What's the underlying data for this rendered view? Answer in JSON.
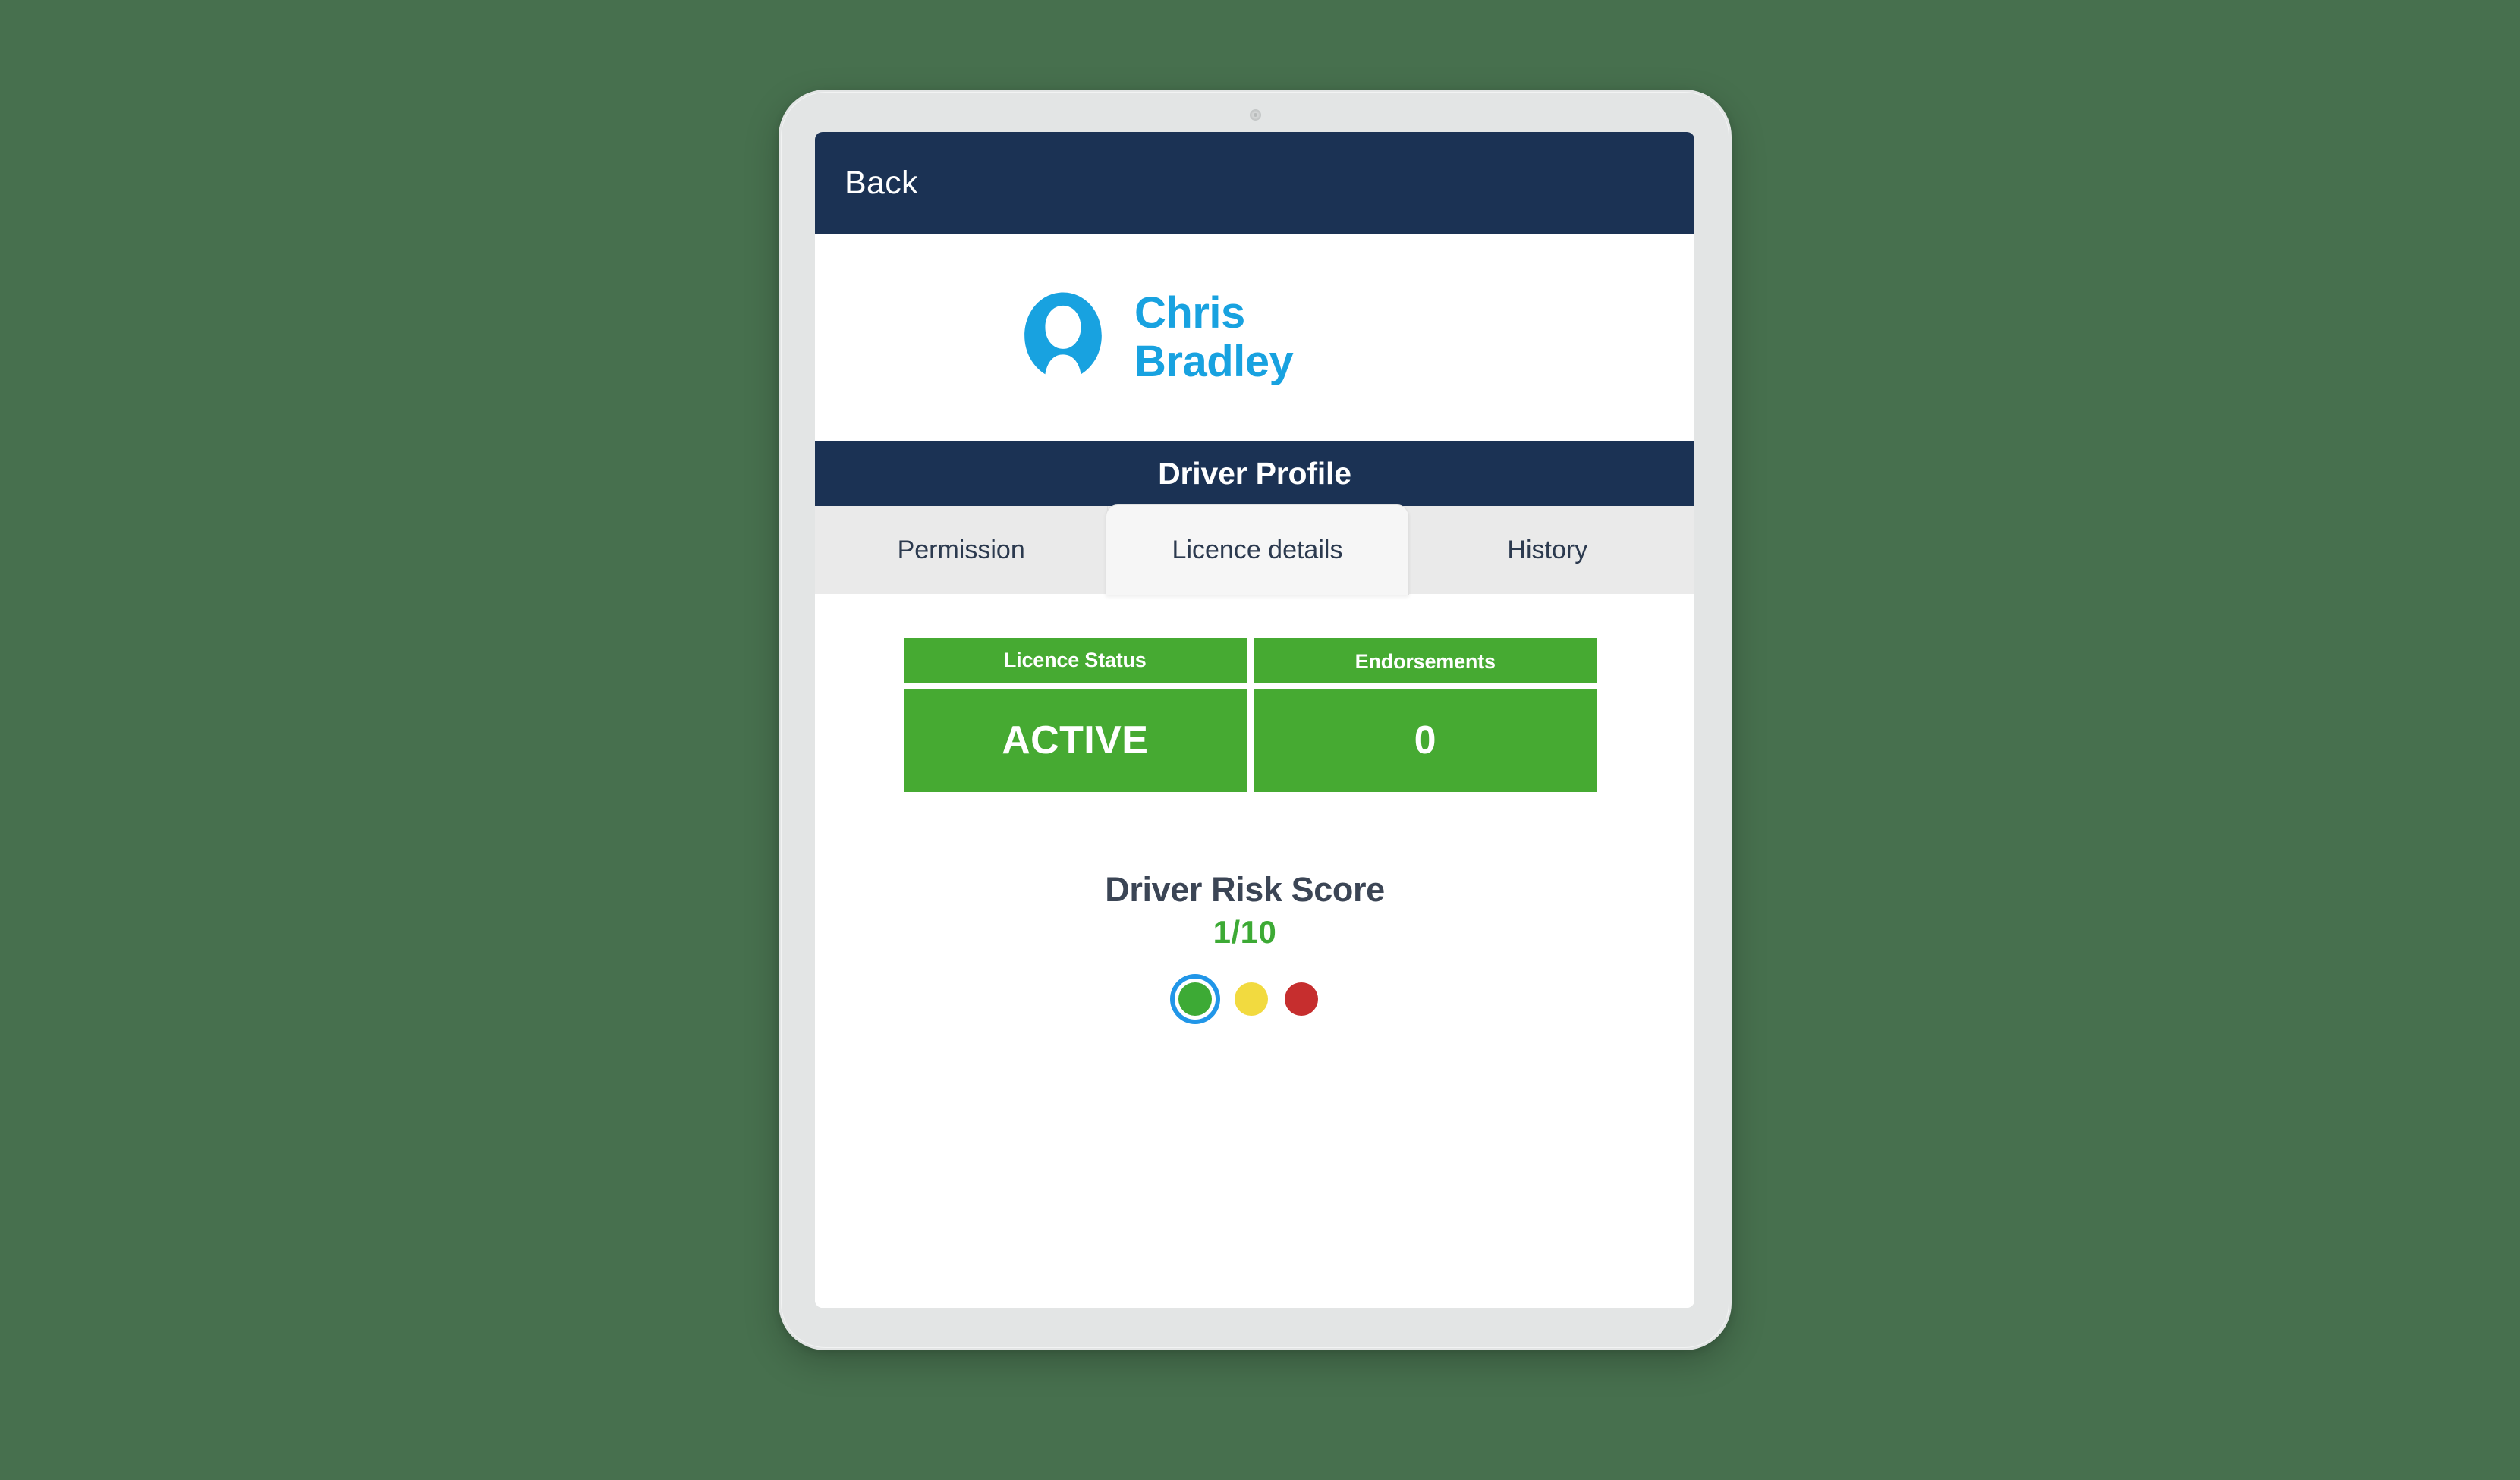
{
  "device": {
    "type": "tablet",
    "camera_icon": "front-camera-icon"
  },
  "topbar": {
    "back_label": "Back"
  },
  "driver": {
    "name_line1": "Chris",
    "name_line2": "Bradley",
    "avatar_icon": "person-avatar-icon",
    "name_color": "#18a2e0"
  },
  "section": {
    "title": "Driver Profile"
  },
  "tabs": {
    "items": [
      {
        "label": "Permission",
        "active": false
      },
      {
        "label": "Licence details",
        "active": true
      },
      {
        "label": "History",
        "active": false
      }
    ]
  },
  "licence": {
    "headers": [
      "Licence Status",
      "Endorsements"
    ],
    "values": [
      "ACTIVE",
      "0"
    ],
    "cell_color": "#46aa32"
  },
  "risk": {
    "title": "Driver Risk Score",
    "value": "1/10",
    "value_color": "#3daa35",
    "dots": [
      {
        "name": "risk-dot-green",
        "color": "#3daa35",
        "selected": true
      },
      {
        "name": "risk-dot-yellow",
        "color": "#f2da3f",
        "selected": false
      },
      {
        "name": "risk-dot-red",
        "color": "#c62e2e",
        "selected": false
      }
    ],
    "selection_ring_color": "#2196e8"
  },
  "theme": {
    "background": "#47704e",
    "navy": "#1b3254",
    "bezel": "#e3e5e5"
  }
}
